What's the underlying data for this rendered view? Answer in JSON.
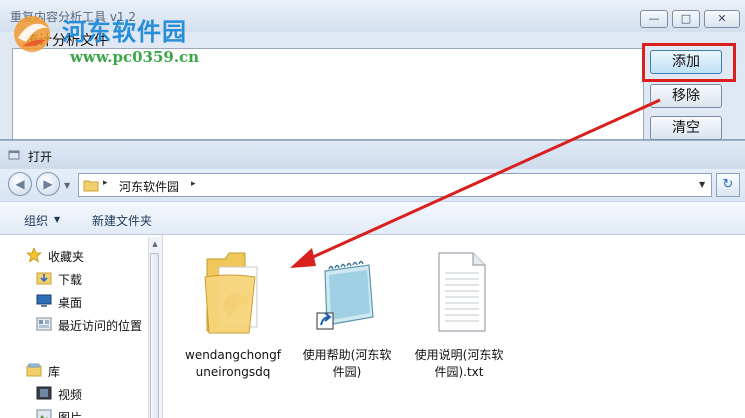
{
  "tool_window": {
    "title": "重复内容分析工具 v1.2",
    "group_label": "统计分析文件",
    "buttons": {
      "add": "添加",
      "remove": "移除",
      "clear": "清空"
    },
    "window_controls": {
      "minimize": "—",
      "maximize": "□",
      "close": "✕"
    }
  },
  "watermark": {
    "title": "河东软件园",
    "url": "www.pc0359.cn"
  },
  "open_dialog": {
    "title": "打开",
    "address": {
      "path_label": "河东软件园",
      "separator": "▸"
    },
    "nav": {
      "back": "◀",
      "forward": "▶",
      "dropdown": "▼",
      "refresh": "↻"
    },
    "toolbar": {
      "organize": "组织",
      "organize_arrow": "▼",
      "new_folder": "新建文件夹"
    },
    "sidebar": {
      "favorites": "收藏夹",
      "downloads": "下载",
      "desktop": "桌面",
      "recent": "最近访问的位置",
      "libraries": "库",
      "videos": "视频",
      "pictures": "图片"
    },
    "files": [
      {
        "label_line1": "wendangchongf",
        "label_line2": "uneirongsdq",
        "type": "folder"
      },
      {
        "label_line1": "使用帮助(河东软",
        "label_line2": "件园)",
        "type": "shortcut"
      },
      {
        "label_line1": "使用说明(河东软",
        "label_line2": "件园).txt",
        "type": "txt"
      }
    ]
  },
  "colors": {
    "highlight": "#d9201f",
    "watermark_blue": "#1f8ad8",
    "watermark_green": "#3aa648"
  }
}
